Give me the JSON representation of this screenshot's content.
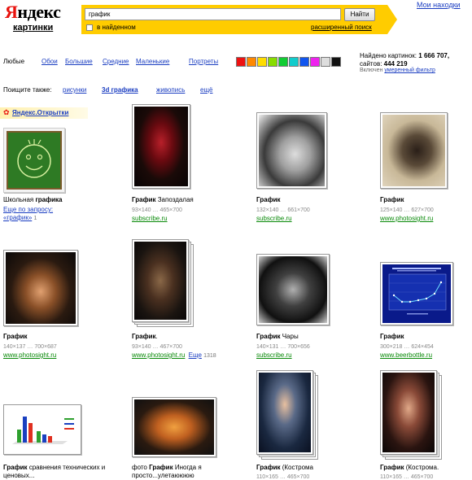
{
  "header": {
    "logo_text": "Яндекс",
    "logo_sub": "картинки",
    "top_link": "Мои находки",
    "search_value": "график",
    "search_button": "Найти",
    "in_found_label": "в найденном",
    "advanced_link": "расширенный поиск"
  },
  "filters": {
    "any": "Любые",
    "wallpapers": "Обои",
    "large": "Большие",
    "medium": "Средние",
    "small": "Маленькие",
    "portraits": "Портреты",
    "colors": [
      "#ee1111",
      "#ff8800",
      "#ffdd00",
      "#88dd00",
      "#11cc33",
      "#11cccc",
      "#1155ee",
      "#ee22ee",
      "#dddddd",
      "#111111"
    ]
  },
  "stats": {
    "found_label": "Найдено картинок:",
    "found_count": "1 666 707,",
    "sites_label": "сайтов:",
    "sites_count": "444 219",
    "filter_prefix": "Включен",
    "filter_link": "умеренный фильтр"
  },
  "also": {
    "label": "Поищите также:",
    "items": [
      "рисунки",
      "3d графика",
      "живопись",
      "ещё"
    ]
  },
  "promo": {
    "icon": "✿",
    "text": "Яндекс.Открытки"
  },
  "results": [
    {
      "title_a": "Школьная ",
      "title_b": "графика",
      "more": "Еще по запросу:",
      "query": "«график»",
      "count": "1"
    },
    {
      "title_a": "График",
      "title_b": " Запоздалая",
      "meta": "93×140 … 465×700",
      "src": "subscribe.ru"
    },
    {
      "title_a": "График",
      "title_b": "",
      "meta": "132×140 … 661×700",
      "src": "subscribe.ru"
    },
    {
      "title_a": "График",
      "title_b": "",
      "meta": "125×140 … 627×700",
      "src": "www.photosight.ru"
    },
    {
      "title_a": "График",
      "title_b": "",
      "meta": "140×137 … 700×687",
      "src": "www.photosight.ru"
    },
    {
      "title_a": "График",
      "title_b": ".",
      "meta": "93×140 … 467×700",
      "src": "www.photosight.ru",
      "more": "Еще",
      "count": "1318"
    },
    {
      "title_a": "График",
      "title_b": " Чары",
      "meta": "140×131 … 700×656",
      "src": "subscribe.ru"
    },
    {
      "title_a": "График",
      "title_b": "",
      "meta": "300×218 … 624×454",
      "src": "www.beerbottle.ru"
    },
    {
      "title_a": "График",
      "title_b": " сравнения технических и ценовых...",
      "meta": "",
      "src": ""
    },
    {
      "title_a": "фото ",
      "title_b": "График",
      "title_c": " Иногда я просто...улетаюююю",
      "meta": "",
      "src": ""
    },
    {
      "title_a": "График",
      "title_b": " (Кострома",
      "meta": "110×165 … 465×700",
      "src": ""
    },
    {
      "title_a": "График",
      "title_b": " (Кострома.",
      "meta": "110×165 … 465×700",
      "src": ""
    }
  ]
}
